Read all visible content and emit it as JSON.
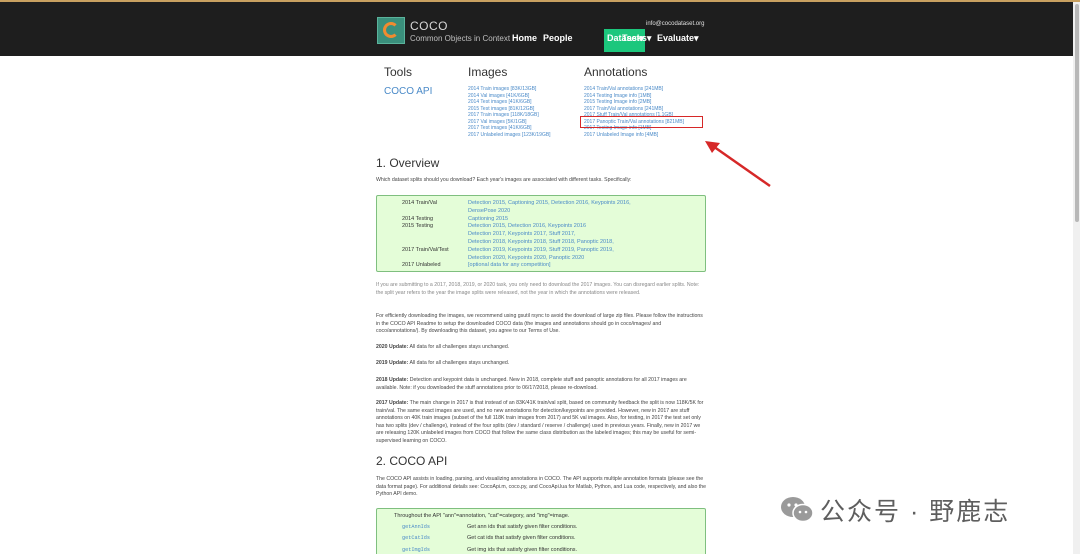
{
  "header": {
    "brand": "COCO",
    "brand_sub": "Common Objects in Context",
    "email": "info@cocodataset.org",
    "nav": [
      "Home",
      "People",
      "Dataset",
      "Tasks",
      "Evaluate"
    ]
  },
  "columns": {
    "tools_title": "Tools",
    "tools_link": "COCO API",
    "images_title": "Images",
    "images": [
      "2014 Train images [83K/13GB]",
      "2014 Val images [41K/6GB]",
      "2014 Test images [41K/6GB]",
      "2015 Test images [81K/12GB]",
      "2017 Train images [118K/18GB]",
      "2017 Val images [5K/1GB]",
      "2017 Test images [41K/6GB]",
      "2017 Unlabeled images [123K/19GB]"
    ],
    "annotations_title": "Annotations",
    "annotations": [
      "2014 Train/Val annotations [241MB]",
      "2014 Testing Image info [1MB]",
      "2015 Testing Image info [2MB]",
      "2017 Train/Val annotations [241MB]",
      "2017 Stuff Train/Val annotations [1.1GB]",
      "2017 Panoptic Train/Val annotations [821MB]",
      "2017 Testing Image info [1MB]",
      "2017 Unlabeled Image info [4MB]"
    ]
  },
  "overview": {
    "title": "1. Overview",
    "intro": "Which dataset splits should you download? Each year's images are associated with different tasks. Specifically:",
    "rows": [
      {
        "year": "2014 Train/Val",
        "tasks": "Detection 2015, Captioning 2015, Detection 2016, Keypoints 2016,"
      },
      {
        "year": "",
        "tasks": "DensePose 2020"
      },
      {
        "year": "2014 Testing",
        "tasks": "Captioning 2015"
      },
      {
        "year": "2015 Testing",
        "tasks": "Detection 2015, Detection 2016, Keypoints 2016"
      },
      {
        "year": "",
        "tasks": "Detection 2017, Keypoints 2017, Stuff 2017,"
      },
      {
        "year": "",
        "tasks": "Detection 2018, Keypoints 2018, Stuff 2018, Panoptic 2018,"
      },
      {
        "year": "2017 Train/Val/Test",
        "tasks": "Detection 2019, Keypoints 2019, Stuff 2019, Panoptic 2019,"
      },
      {
        "year": "",
        "tasks": "Detection 2020, Keypoints 2020, Panoptic 2020"
      },
      {
        "year": "2017 Unlabeled",
        "tasks": "[optional data for any competition]"
      }
    ],
    "note": "If you are submitting to a 2017, 2018, 2019, or 2020 task, you only need to download the 2017 images. You can disregard earlier splits. Note: the split year refers to the year the image splits were released, not the year in which the annotations were released.",
    "download_tip": "For efficiently downloading the images, we recommend using gsutil rsync to avoid the download of large zip files. Please follow the instructions in the COCO API Readme to setup the downloaded COCO data (the images and annotations should go in coco/images/ and coco/annotations/). By downloading this dataset, you agree to our Terms of Use.",
    "update_2020_label": "2020 Update:",
    "update_2020": "All data for all challenges stays unchanged.",
    "update_2019_label": "2019 Update:",
    "update_2019": "All data for all challenges stays unchanged.",
    "update_2018_label": "2018 Update:",
    "update_2018": "Detection and keypoint data is unchanged. New in 2018, complete stuff and panoptic annotations for all 2017 images are available. Note: if you downloaded the stuff annotations prior to 06/17/2018, please re-download.",
    "update_2017_label": "2017 Update:",
    "update_2017": "The main change in 2017 is that instead of an 83K/41K train/val split, based on community feedback the split is now 118K/5K for train/val. The same exact images are used, and no new annotations for detection/keypoints are provided. However, new in 2017 are stuff annotations on 40K train images (subset of the full 118K train images from 2017) and 5K val images. Also, for testing, in 2017 the test set only has two splits (dev / challenge), instead of the four splits (dev / standard / reserve / challenge) used in previous years. Finally, new in 2017 we are releasing 120K unlabeled images from COCO that follow the same class distribution as the labeled images; this may be useful for semi-supervised learning on COCO."
  },
  "cocoapi": {
    "title": "2. COCO API",
    "intro": "The COCO API assists in loading, parsing, and visualizing annotations in COCO. The API supports multiple annotation formats (please see the data format page). For additional details see: CocoApi.m, coco.py, and CocoApi.lua for Matlab, Python, and Lua code, respectively, and also the Python API demo.",
    "box_head": "Throughout the API \"ann\"=annotation, \"cat\"=category, and \"img\"=image.",
    "functions": [
      {
        "name": "getAnnIds",
        "desc": "Get ann ids that satisfy given filter conditions."
      },
      {
        "name": "getCatIds",
        "desc": "Get cat ids that satisfy given filter conditions."
      },
      {
        "name": "getImgIds",
        "desc": "Get img ids that satisfy given filter conditions."
      }
    ]
  },
  "watermark": {
    "text": "公众号 · 野鹿志"
  },
  "colors": {
    "navbar": "#1e1e1e",
    "active_nav": "#1cc77d",
    "link": "#4a8ac8",
    "highlight": "#d62828",
    "green_box": "#e4fdd8"
  }
}
